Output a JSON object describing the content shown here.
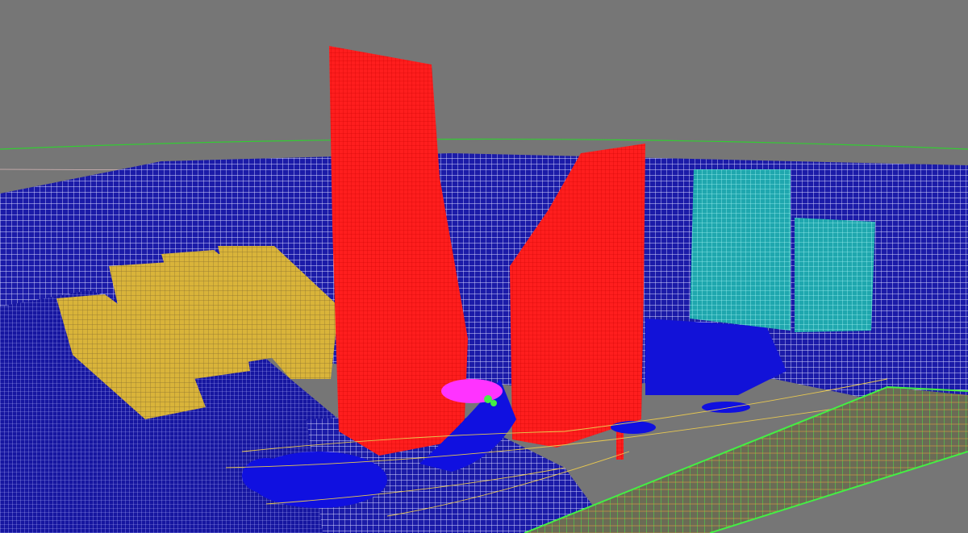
{
  "viewport": {
    "background": "#767676",
    "render_style": "wireframe"
  },
  "colors": {
    "towers": "#ff1a1a",
    "context_buildings": "#1a1ab8",
    "context_lines": "#c8c8ff",
    "residential_blocks": "#e6c040",
    "teal_towers": "#22b8c0",
    "plaza_water": "#1010e0",
    "roads": "#e8c850",
    "viaduct": "#44ee44",
    "pink_object": "#ff33ff",
    "ground_line": "#22dd22"
  },
  "scene_objects": [
    "tall-red-tower",
    "short-red-tower",
    "teal-tower",
    "yellow-residential-blocks",
    "blue-context-buildings",
    "blue-plaza",
    "green-viaduct",
    "magenta-sculpture"
  ]
}
